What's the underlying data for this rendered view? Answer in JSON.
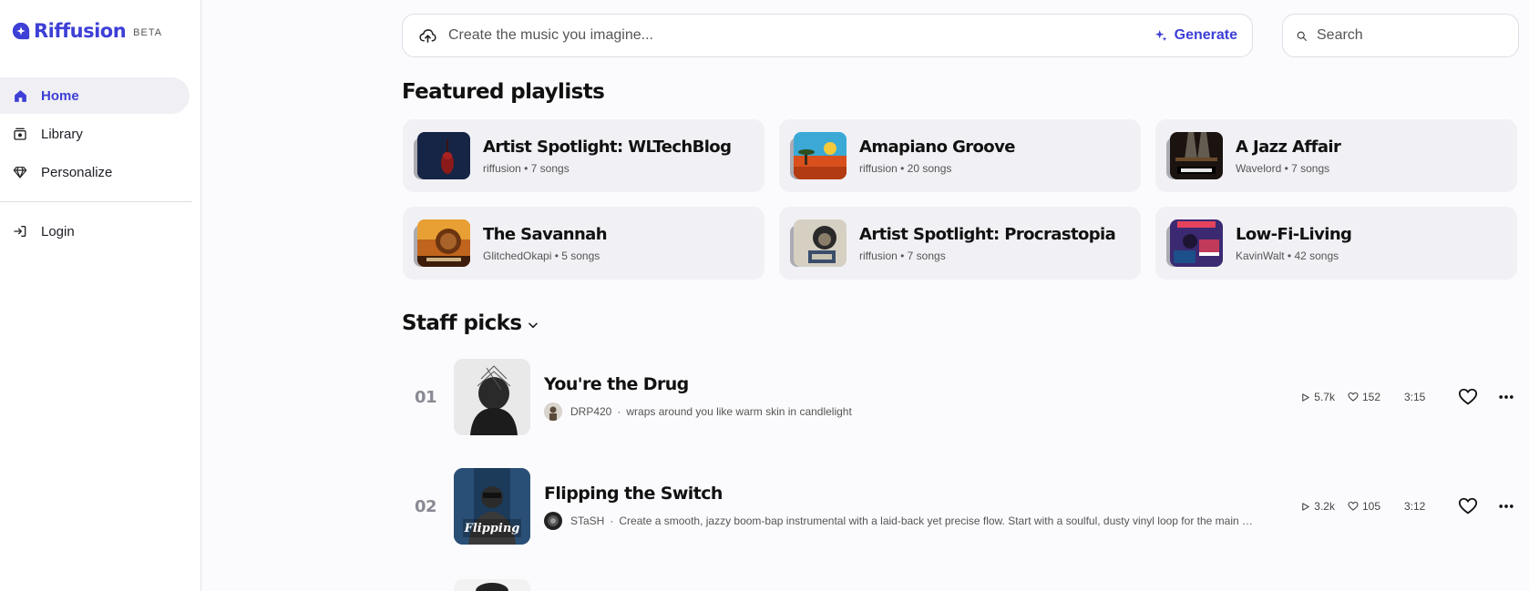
{
  "app": {
    "brand": "Riffusion",
    "badge": "BETA"
  },
  "sidebar": {
    "items": [
      {
        "label": "Home",
        "icon": "home-icon",
        "active": true
      },
      {
        "label": "Library",
        "icon": "library-icon",
        "active": false
      },
      {
        "label": "Personalize",
        "icon": "diamond-icon",
        "active": false
      }
    ],
    "login": {
      "label": "Login",
      "icon": "login-icon"
    }
  },
  "prompt": {
    "placeholder": "Create the music you imagine...",
    "generate_label": "Generate"
  },
  "search": {
    "placeholder": "Search"
  },
  "featured": {
    "title": "Featured playlists",
    "playlists": [
      {
        "name": "Artist Spotlight: WLTechBlog",
        "meta": "riffusion • 7 songs",
        "cover_color": "#0e1a33"
      },
      {
        "name": "Amapiano Groove",
        "meta": "riffusion • 20 songs",
        "cover_color": "#3aa9d6"
      },
      {
        "name": "A Jazz Affair",
        "meta": "Wavelord • 7 songs",
        "cover_color": "#1a1310"
      },
      {
        "name": "The Savannah",
        "meta": "GlitchedOkapi • 5 songs",
        "cover_color": "#c0641e"
      },
      {
        "name": "Artist Spotlight: Procrastopia",
        "meta": "riffusion • 7 songs",
        "cover_color": "#c9c3b4"
      },
      {
        "name": "Low-Fi-Living",
        "meta": "KavinWalt • 42 songs",
        "cover_color": "#3b2a72"
      }
    ]
  },
  "staff_picks": {
    "title": "Staff picks",
    "tracks": [
      {
        "num": "01",
        "title": "You're the Drug",
        "artist": "DRP420",
        "description": "wraps around you like warm skin in candlelight",
        "plays": "5.7k",
        "likes": "152",
        "duration": "3:15"
      },
      {
        "num": "02",
        "title": "Flipping the Switch",
        "artist": "STaSH",
        "description": "Create a smooth, jazzy boom-bap instrumental with a laid-back yet precise flow. Start with a soulful, dusty vinyl loop for the main groove",
        "plays": "3.2k",
        "likes": "105",
        "duration": "3:12"
      }
    ]
  },
  "colors": {
    "accent": "#3d3fd6",
    "card_bg": "#f1f1f5",
    "page_bg": "#fbfbfd"
  }
}
